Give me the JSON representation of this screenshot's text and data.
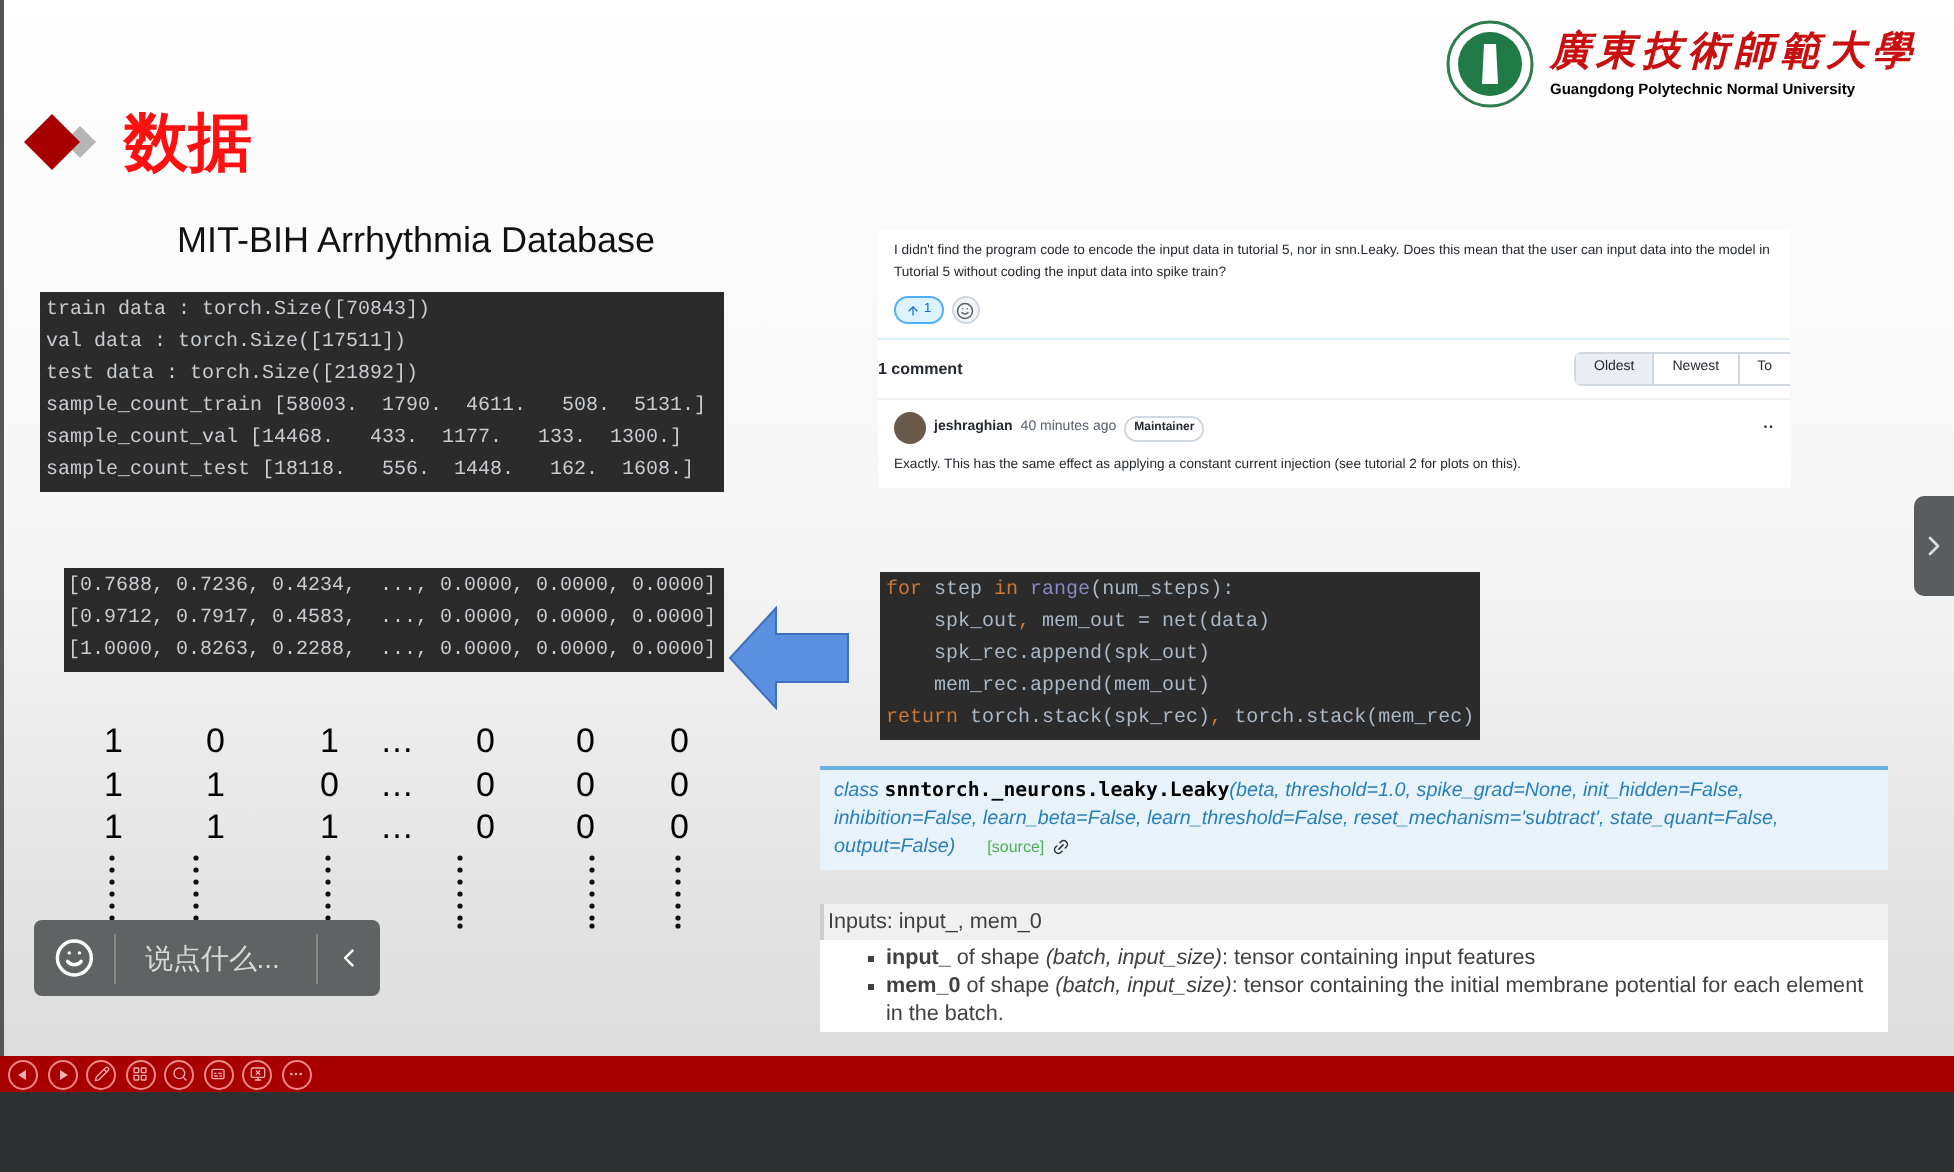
{
  "header": {
    "title": "数据",
    "university_name": "廣東技術師範大學",
    "university_name_en": "Guangdong Polytechnic Normal University"
  },
  "dataset_title": "MIT-BIH Arrhythmia Database",
  "stats_output": [
    "train data : torch.Size([70843])",
    "val data : torch.Size([17511])",
    "test data : torch.Size([21892])",
    "sample_count_train [58003.  1790.  4611.   508.  5131.]",
    "sample_count_val [14468.   433.  1177.   133.  1300.]",
    "sample_count_test [18118.   556.  1448.   162.  1608.]"
  ],
  "tensor_output": [
    "[0.7688, 0.7236, 0.4234,  ..., 0.0000, 0.0000, 0.0000]",
    "[0.9712, 0.7917, 0.4583,  ..., 0.0000, 0.0000, 0.0000]",
    "[1.0000, 0.8263, 0.2288,  ..., 0.0000, 0.0000, 0.0000]"
  ],
  "spike_matrix": [
    [
      "1",
      "0",
      "1",
      "…",
      "0",
      "0",
      "0"
    ],
    [
      "1",
      "1",
      "0",
      "…",
      "0",
      "0",
      "0"
    ],
    [
      "1",
      "1",
      "1",
      "…",
      "0",
      "0",
      "0"
    ]
  ],
  "chat_widget": {
    "placeholder": "说点什么..."
  },
  "discussion": {
    "question": "I didn't find the program code to encode the input data in tutorial 5, nor in snn.Leaky. Does this mean that the user can input data into the model in Tutorial 5 without coding the input data into spike train?",
    "upvotes": "1",
    "comment_count": "1 comment",
    "sort_tabs": [
      {
        "label": "Oldest",
        "selected": true
      },
      {
        "label": "Newest",
        "selected": false
      },
      {
        "label": "To",
        "selected": false
      }
    ],
    "comment": {
      "author": "jeshraghian",
      "time": "40 minutes ago",
      "badge": "Maintainer",
      "menu": "··",
      "body": "Exactly. This has the same effect as applying a constant current injection (see tutorial 2 for plots on this)."
    }
  },
  "code_snippet": [
    [
      {
        "text": "for",
        "kind": "keyword"
      },
      {
        "text": " step ",
        "kind": "plain"
      },
      {
        "text": "in",
        "kind": "keyword"
      },
      {
        "text": " range",
        "kind": "builtin"
      },
      {
        "text": "(num_steps):",
        "kind": "plain"
      }
    ],
    [
      {
        "text": "    spk_out",
        "kind": "plain"
      },
      {
        "text": ",",
        "kind": "keyword"
      },
      {
        "text": " mem_out = net(data)",
        "kind": "plain"
      }
    ],
    [
      {
        "text": "    spk_rec.append(spk_out)",
        "kind": "plain"
      }
    ],
    [
      {
        "text": "    mem_rec.append(mem_out)",
        "kind": "plain"
      }
    ],
    [
      {
        "text": "return",
        "kind": "keyword"
      },
      {
        "text": " torch.stack(spk_rec)",
        "kind": "plain"
      },
      {
        "text": ",",
        "kind": "keyword"
      },
      {
        "text": " torch.stack(mem_rec)",
        "kind": "plain"
      }
    ]
  ],
  "api_doc": {
    "keyword": "class",
    "name": "snntorch._neurons.leaky.Leaky",
    "params": "(beta, threshold=1.0, spike_grad=None, init_hidden=False, inhibition=False, learn_beta=False, learn_threshold=False, reset_mechanism='subtract', state_quant=False, output=False)",
    "source_link": "[source]"
  },
  "inputs_doc": {
    "heading": "Inputs: input_, mem_0",
    "items": [
      "**input_** of shape *(batch, input_size)*: tensor containing input features",
      "**mem_0** of shape *(batch, input_size)*: tensor containing the initial membrane potential for each element in the batch."
    ]
  }
}
